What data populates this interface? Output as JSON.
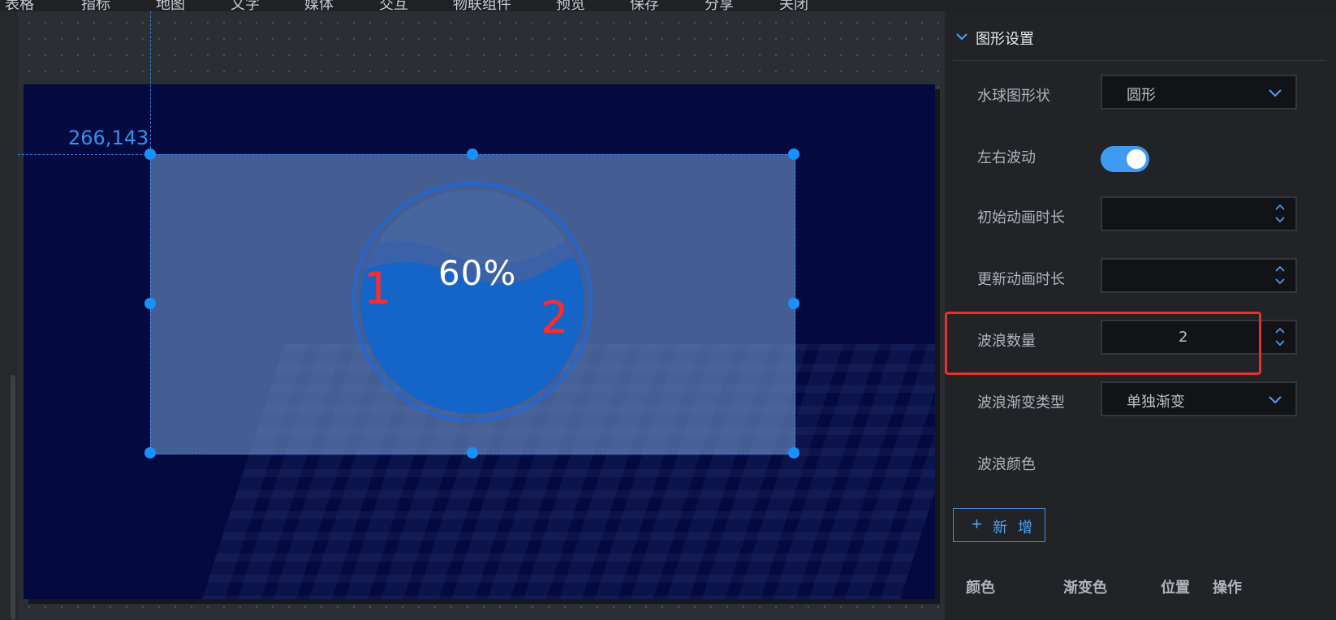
{
  "menu": {
    "items": [
      "表格",
      "指标",
      "地图",
      "文字",
      "媒体",
      "交互",
      "物联组件",
      "预览",
      "保存",
      "分享",
      "关闭"
    ]
  },
  "canvas": {
    "coordinates": "266,143",
    "liquid_percent_label": "60%",
    "liquid_value": 0.6,
    "annotations": [
      "1",
      "2"
    ]
  },
  "panel": {
    "section_title": "图形设置",
    "shape_label": "水球图形状",
    "shape_value": "圆形",
    "sway_label": "左右波动",
    "sway_on": true,
    "initial_anim_label": "初始动画时长",
    "initial_anim_value": "",
    "update_anim_label": "更新动画时长",
    "update_anim_value": "",
    "wave_count_label": "波浪数量",
    "wave_count_value": "2",
    "gradient_type_label": "波浪渐变类型",
    "gradient_type_value": "单独渐变",
    "wave_color_label": "波浪颜色",
    "add_button_label": "新 增",
    "table_headers": [
      "颜色",
      "渐变色",
      "位置",
      "操作"
    ]
  },
  "colors": {
    "accent": "#1890ff",
    "highlight": "#e8312a",
    "screen_bg": "#040a3f"
  }
}
